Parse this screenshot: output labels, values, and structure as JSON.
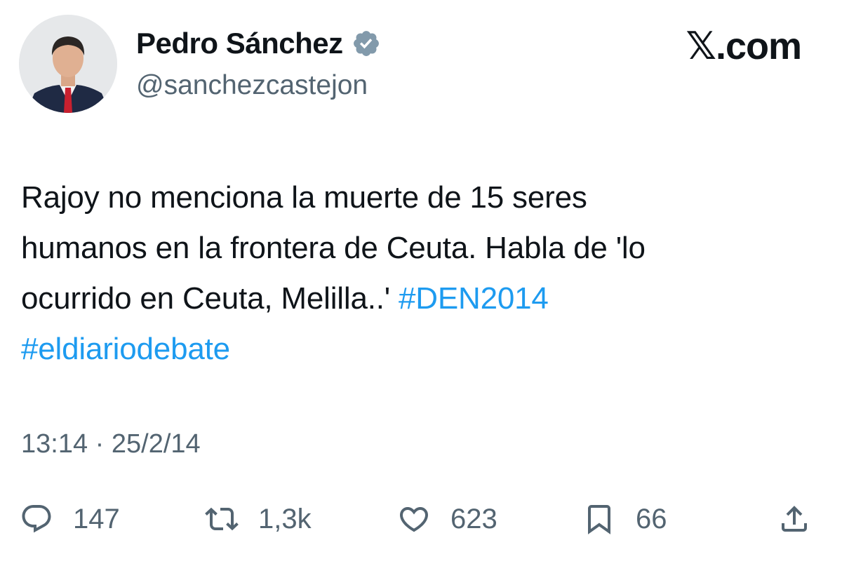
{
  "author": {
    "display_name": "Pedro Sánchez",
    "handle": "@sanchezcastejon",
    "verified_icon": "verified-badge-icon"
  },
  "brand": {
    "label": "𝕏.com"
  },
  "tweet": {
    "line1": "Rajoy no menciona la muerte de 15 seres",
    "line2": "humanos en la frontera de Ceuta. Habla de 'lo",
    "line3_text": "ocurrido en Ceuta, Melilla..' ",
    "hashtag1": "#DEN2014",
    "hashtag2": "#eldiariodebate",
    "timestamp": "13:14 · 25/2/14"
  },
  "actions": {
    "reply": {
      "icon": "reply-icon",
      "count": "147"
    },
    "repost": {
      "icon": "repost-icon",
      "count": "1,3k"
    },
    "like": {
      "icon": "heart-icon",
      "count": "623"
    },
    "bookmark": {
      "icon": "bookmark-icon",
      "count": "66"
    },
    "share": {
      "icon": "share-icon"
    }
  },
  "colors": {
    "text": "#0f1419",
    "secondary": "#536471",
    "hashtag": "#1d9bf0",
    "verified_badge": "#829aab"
  }
}
